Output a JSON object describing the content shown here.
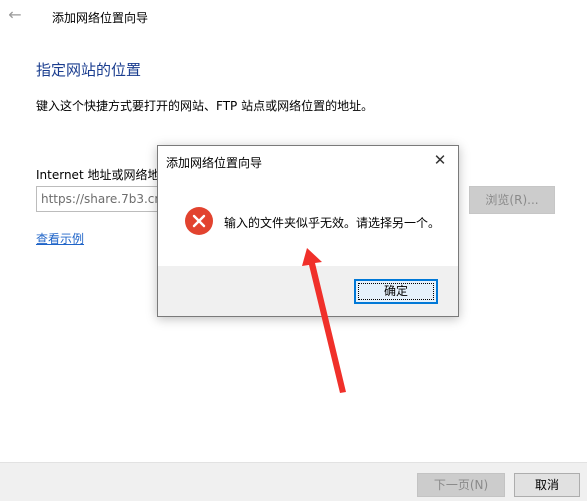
{
  "wizard": {
    "back_icon": "arrow-left-icon",
    "title": "添加网络位置向导",
    "heading": "指定网站的位置",
    "description": "键入这个快捷方式要打开的网站、FTP 站点或网络位置的地址。",
    "address_label": "Internet 地址或网络地址",
    "address_value": "https://share.7b3.cn/",
    "browse_label": "浏览(R)...",
    "example_link": "查看示例",
    "next_label": "下一页(N)",
    "cancel_label": "取消"
  },
  "dialog": {
    "title": "添加网络位置向导",
    "close_icon": "close-icon",
    "error_icon": "error-icon",
    "message": "输入的文件夹似乎无效。请选择另一个。",
    "ok_label": "确定"
  },
  "annotation": {
    "type": "red-arrow",
    "color": "#f0302a"
  },
  "colors": {
    "heading": "#1a3d8f",
    "link": "#1f64c8",
    "error": "#e2432f",
    "focus": "#0078d7"
  }
}
